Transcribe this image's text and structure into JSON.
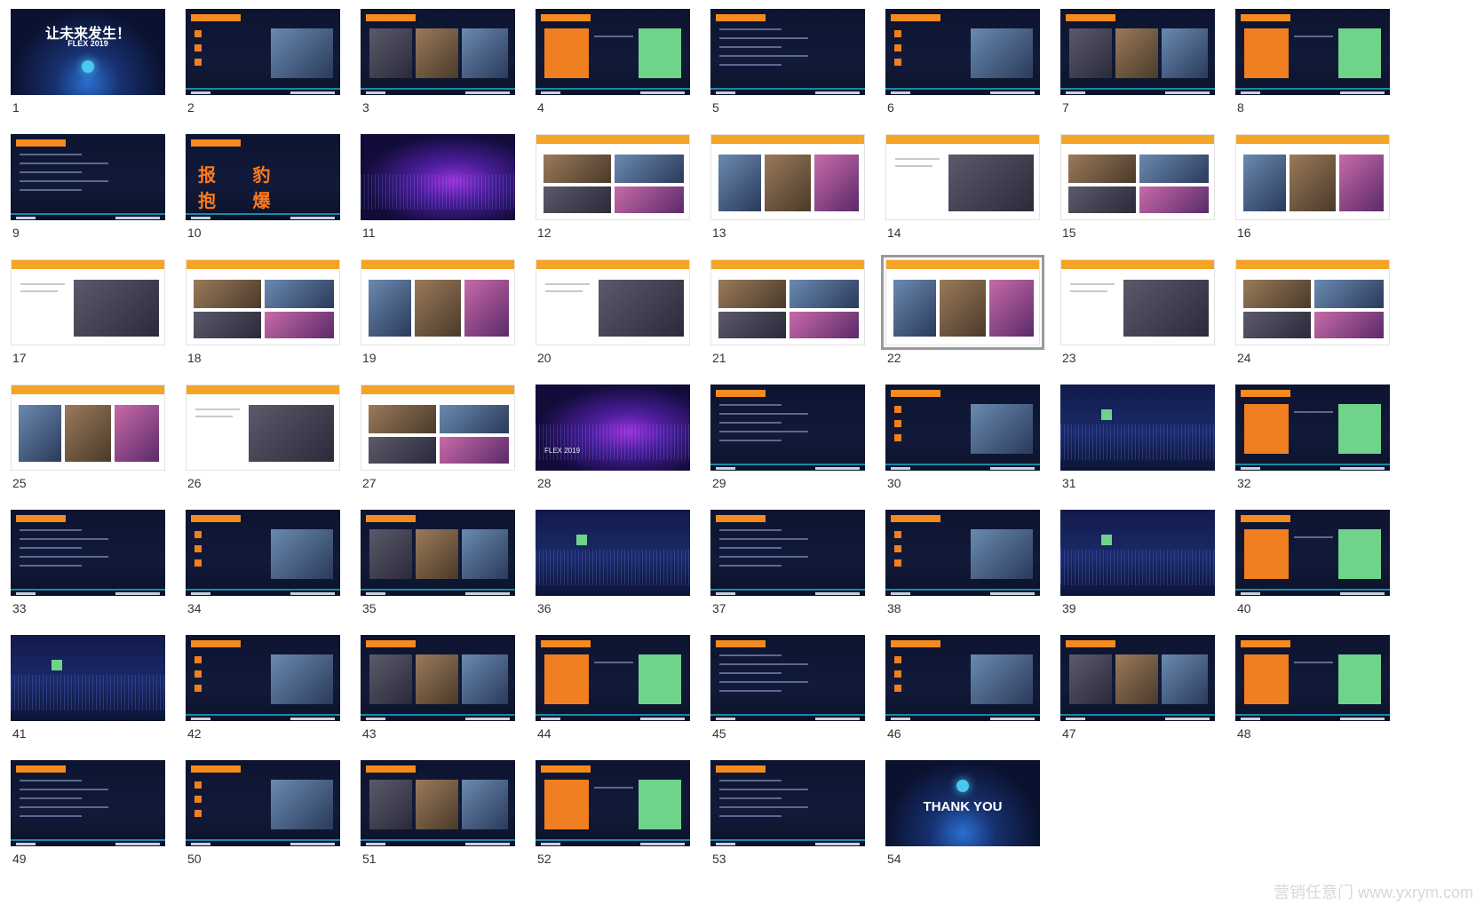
{
  "slides": [
    {
      "num": "1",
      "theme": "cover",
      "title": "让未来发生！",
      "subtitle": "FLEX 2019"
    },
    {
      "num": "2",
      "theme": "dark"
    },
    {
      "num": "3",
      "theme": "dark"
    },
    {
      "num": "4",
      "theme": "dark"
    },
    {
      "num": "5",
      "theme": "dark"
    },
    {
      "num": "6",
      "theme": "dark"
    },
    {
      "num": "7",
      "theme": "dark"
    },
    {
      "num": "8",
      "theme": "dark"
    },
    {
      "num": "9",
      "theme": "dark"
    },
    {
      "num": "10",
      "theme": "dark",
      "big_text": "报 豹 抱 爆"
    },
    {
      "num": "11",
      "theme": "wave"
    },
    {
      "num": "12",
      "theme": "white"
    },
    {
      "num": "13",
      "theme": "white"
    },
    {
      "num": "14",
      "theme": "white"
    },
    {
      "num": "15",
      "theme": "white"
    },
    {
      "num": "16",
      "theme": "white"
    },
    {
      "num": "17",
      "theme": "white"
    },
    {
      "num": "18",
      "theme": "white"
    },
    {
      "num": "19",
      "theme": "white"
    },
    {
      "num": "20",
      "theme": "white"
    },
    {
      "num": "21",
      "theme": "white"
    },
    {
      "num": "22",
      "theme": "white",
      "selected": true
    },
    {
      "num": "23",
      "theme": "white"
    },
    {
      "num": "24",
      "theme": "white"
    },
    {
      "num": "25",
      "theme": "white"
    },
    {
      "num": "26",
      "theme": "white"
    },
    {
      "num": "27",
      "theme": "white"
    },
    {
      "num": "28",
      "theme": "wave",
      "subtitle": "FLEX 2019"
    },
    {
      "num": "29",
      "theme": "dark"
    },
    {
      "num": "30",
      "theme": "dark"
    },
    {
      "num": "31",
      "theme": "blue-wave"
    },
    {
      "num": "32",
      "theme": "dark"
    },
    {
      "num": "33",
      "theme": "dark"
    },
    {
      "num": "34",
      "theme": "dark"
    },
    {
      "num": "35",
      "theme": "dark"
    },
    {
      "num": "36",
      "theme": "blue-wave"
    },
    {
      "num": "37",
      "theme": "dark"
    },
    {
      "num": "38",
      "theme": "dark"
    },
    {
      "num": "39",
      "theme": "blue-wave"
    },
    {
      "num": "40",
      "theme": "dark"
    },
    {
      "num": "41",
      "theme": "blue-wave"
    },
    {
      "num": "42",
      "theme": "dark"
    },
    {
      "num": "43",
      "theme": "dark"
    },
    {
      "num": "44",
      "theme": "dark"
    },
    {
      "num": "45",
      "theme": "dark"
    },
    {
      "num": "46",
      "theme": "dark"
    },
    {
      "num": "47",
      "theme": "dark"
    },
    {
      "num": "48",
      "theme": "dark"
    },
    {
      "num": "49",
      "theme": "dark"
    },
    {
      "num": "50",
      "theme": "dark"
    },
    {
      "num": "51",
      "theme": "dark"
    },
    {
      "num": "52",
      "theme": "dark"
    },
    {
      "num": "53",
      "theme": "dark"
    },
    {
      "num": "54",
      "theme": "cover",
      "title": "THANK YOU"
    }
  ],
  "watermark": "营销任意门 www.yxrym.com",
  "colors": {
    "accent_orange": "#f4a426",
    "tag_orange": "#f58a1f",
    "footer_cyan": "#1aa9c8",
    "selection": "#9a9a9a"
  }
}
